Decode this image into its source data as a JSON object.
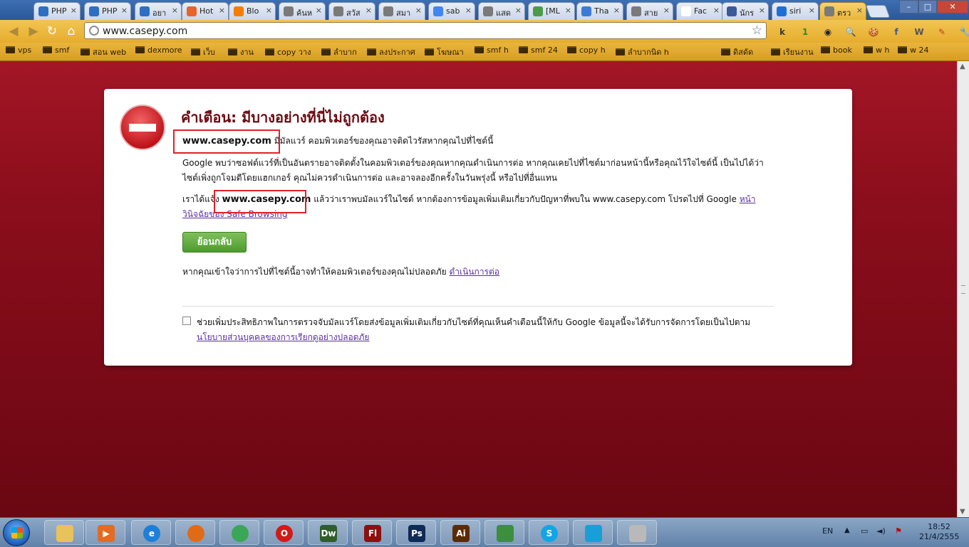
{
  "tabs": [
    {
      "title": "PHP",
      "color": "#2d6fc1"
    },
    {
      "title": "PHP",
      "color": "#2d6fc1"
    },
    {
      "title": "อยา",
      "color": "#2d6fc1"
    },
    {
      "title": "Hot",
      "color": "#e8632a"
    },
    {
      "title": "Blo",
      "color": "#f57d00"
    },
    {
      "title": "ค้นห",
      "color": "#7a7a7a"
    },
    {
      "title": "สวัส",
      "color": "#7a7a7a"
    },
    {
      "title": "สมา",
      "color": "#7a7a7a"
    },
    {
      "title": "sab",
      "color": "#4285f4"
    },
    {
      "title": "แสด",
      "color": "#7a7a7a"
    },
    {
      "title": "[ML",
      "color": "#4a9b4a"
    },
    {
      "title": "Tha",
      "color": "#3b7bd6"
    },
    {
      "title": "สาย",
      "color": "#7a7a7a"
    },
    {
      "title": "Fac",
      "color": "#ffffff"
    },
    {
      "title": "นักร",
      "color": "#3b5998"
    },
    {
      "title": "siri",
      "color": "#1f6fd6"
    },
    {
      "title": "ตรว",
      "color": "#7a7a7a",
      "active": true
    }
  ],
  "window": {
    "minimize": "–",
    "maximize": "□",
    "close": "✕"
  },
  "toolbar": {
    "url": "www.casepy.com",
    "back_icon": "back-arrow-icon",
    "forward_icon": "forward-arrow-icon",
    "reload_icon": "reload-icon",
    "home_icon": "home-icon"
  },
  "extensions": [
    "k",
    "1",
    "◉",
    "🔍",
    "🍪",
    "f",
    "W",
    "✎",
    "🔧"
  ],
  "bookmarks": [
    "vps",
    "smf",
    "สอน web",
    "dexmore",
    "เว็บ",
    "งาน",
    "copy วาง",
    "ลำบาก",
    "ลงประกาศ",
    "โฆษณา",
    "smf h",
    "smf 24",
    "copy h",
    "ลำบากนิด h",
    "ดิสดัด",
    "เรียนงาน",
    "book",
    "w h",
    "w 24"
  ],
  "warning": {
    "title": "คำเตือน: มีบางอย่างที่นี่ไม่ถูกต้อง",
    "site": "www.casepy.com",
    "line1_rest": " มีมัลแวร์ คอมพิวเตอร์ของคุณอาจติดไวรัสหากคุณไปที่ไซต์นี้",
    "paragraph": "Google พบว่าซอฟต์แวร์ที่เป็นอันตรายอาจติดตั้งในคอมพิวเตอร์ของคุณหากคุณดำเนินการต่อ หากคุณเคยไปที่ไซต์มาก่อนหน้านี้หรือคุณไว้ใจไซต์นี้ เป็นไปได้ว่าไซต์เพิ่งถูกโจมตีโดยแฮกเกอร์ คุณไม่ควรดำเนินการต่อ และอาจลองอีกครั้งในวันพรุ่งนี้ หรือไปที่อื่นแทน",
    "line3_pre": "เราได้แจ้ง ",
    "line3_site": "www.casepy.com",
    "line3_mid": " แล้วว่าเราพบมัลแวร์ในไซต์ หากต้องการข้อมูลเพิ่มเติมเกี่ยวกับปัญหาที่พบใน www.casepy.com โปรดไปที่ Google ",
    "line3_link": "หน้าวินิจฉัยของ Safe Browsing",
    "back_button": "ย้อนกลับ",
    "proceed_text": "หากคุณเข้าใจว่าการไปที่ไซต์นี้อาจทำให้คอมพิวเตอร์ของคุณไม่ปลอดภัย ",
    "proceed_link": "ดำเนินการต่อ",
    "checkbox_text": "ช่วยเพิ่มประสิทธิภาพในการตรวจจับมัลแวร์โดยส่งข้อมูลเพิ่มเติมเกี่ยวกับไซต์ที่คุณเห็นคำเตือนนี้ให้กับ Google ข้อมูลนี้จะได้รับการจัดการโดยเป็นไปตาม ",
    "checkbox_link": "นโยบายส่วนบุคคลของการเรียกดูอย่างปลอดภัย"
  },
  "taskbar": {
    "apps": [
      {
        "name": "explorer",
        "label": "",
        "color": "#e8c25a"
      },
      {
        "name": "media-player",
        "label": "▶",
        "color": "#e46b1f"
      },
      {
        "name": "internet-explorer",
        "label": "e",
        "color": "#1e7fd8"
      },
      {
        "name": "firefox",
        "label": "",
        "color": "#e06b16"
      },
      {
        "name": "chrome",
        "label": "",
        "color": "#3aa757"
      },
      {
        "name": "opera",
        "label": "O",
        "color": "#d11a1a"
      },
      {
        "name": "dreamweaver",
        "label": "Dw",
        "color": "#2f5d2c"
      },
      {
        "name": "flash",
        "label": "Fl",
        "color": "#8c1010"
      },
      {
        "name": "photoshop",
        "label": "Ps",
        "color": "#0f2a55"
      },
      {
        "name": "illustrator",
        "label": "Ai",
        "color": "#5a2b06"
      },
      {
        "name": "messenger",
        "label": "",
        "color": "#3c8f3c"
      },
      {
        "name": "skype",
        "label": "S",
        "color": "#12a5e6"
      },
      {
        "name": "dtac",
        "label": "",
        "color": "#1a9ed8"
      },
      {
        "name": "app",
        "label": "",
        "color": "#b9b9b9"
      }
    ],
    "lang": "EN",
    "time": "18:52",
    "date": "21/4/2555"
  }
}
